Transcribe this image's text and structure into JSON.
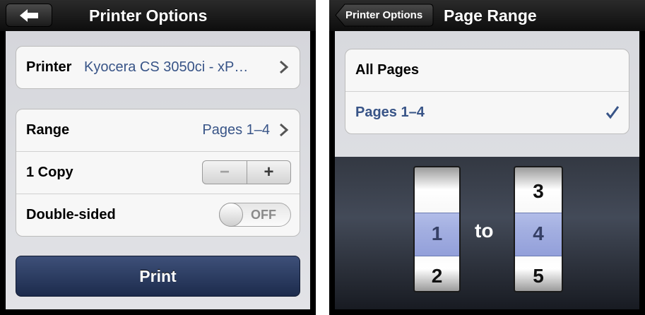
{
  "left": {
    "nav": {
      "title": "Printer Options"
    },
    "printer": {
      "label": "Printer",
      "value": "Kyocera CS 3050ci - xP…"
    },
    "range": {
      "label": "Range",
      "value": "Pages 1–4"
    },
    "copies": {
      "label": "1 Copy",
      "minus": "−",
      "plus": "+"
    },
    "double_sided": {
      "label": "Double-sided",
      "state": "OFF"
    },
    "print_button": "Print"
  },
  "right": {
    "nav": {
      "back_label": "Printer Options",
      "title": "Page Range"
    },
    "options": [
      {
        "label": "All Pages",
        "selected": false
      },
      {
        "label": "Pages 1–4",
        "selected": true
      }
    ],
    "picker": {
      "from": {
        "above": "",
        "selected": "1",
        "below": "2"
      },
      "to_label": "to",
      "to": {
        "above": "3",
        "selected": "4",
        "below": "5"
      }
    }
  },
  "colors": {
    "selected_text": "#385487",
    "print_button": "#1c2b4c",
    "nav_bar": "#111111",
    "form_background": "#d9dadf"
  }
}
